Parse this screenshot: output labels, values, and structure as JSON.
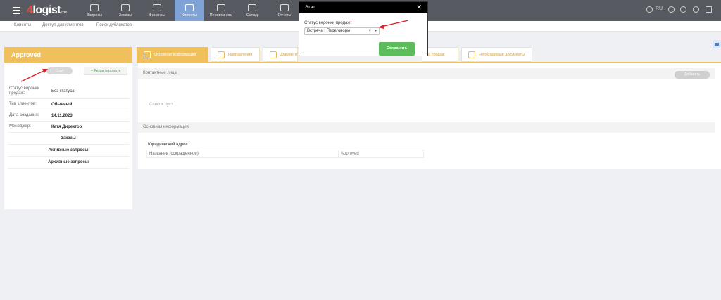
{
  "header": {
    "logo_prefix": "4",
    "logo_text": "logist",
    "logo_suffix": ".com",
    "nav": [
      {
        "label": "Запросы"
      },
      {
        "label": "Заказы"
      },
      {
        "label": "Финансы"
      },
      {
        "label": "Клиенты"
      },
      {
        "label": "Перевозчики"
      },
      {
        "label": "Склад"
      },
      {
        "label": "Отчеты"
      }
    ],
    "lang": "RU"
  },
  "subnav": {
    "items": [
      "Клиенты",
      "Доступ для клиентов",
      "Поиск дубликатов"
    ]
  },
  "client": {
    "name": "Approved",
    "etap_button": "Этап",
    "edit_button": "+ Редактировать",
    "fields": [
      {
        "label": "Статус воронки продаж:",
        "value": "Без статуса"
      },
      {
        "label": "Тип клиентов:",
        "value": "Обычный"
      },
      {
        "label": "Дата создания:",
        "value": "14.11.2023"
      },
      {
        "label": "Менеджер:",
        "value": "Катя Директор"
      }
    ],
    "links": [
      "Заказы",
      "Активные запросы",
      "Архивные запросы"
    ]
  },
  "tabs": [
    {
      "label": "Основная информация",
      "active": true
    },
    {
      "label": "Направления",
      "active": false
    },
    {
      "label": "Документ",
      "active": false
    },
    {
      "label": "а продаж",
      "active": false
    },
    {
      "label": "Необходимые документы",
      "active": false
    }
  ],
  "contacts": {
    "title": "Контактные лица",
    "add_button": "Добавить",
    "empty_text": "Список пуст..."
  },
  "basic_info": {
    "title": "Основная информация",
    "address_title": "Юридический адрес:",
    "row_label": "Название (сокращенное):",
    "row_value": "Approved"
  },
  "modal": {
    "title": "Этап",
    "close": "✕",
    "field_label": "Статус воронки продаж",
    "required_mark": "*",
    "selected_value": "Встреча | Переговоры",
    "clear": "×",
    "caret": "▾",
    "save_button": "Сохранить"
  },
  "colors": {
    "topbar": "#575a60",
    "active_nav": "#7fa3d6",
    "accent": "#f0c05c",
    "save": "#5cbc5c",
    "annotation_arrow": "#d9222a"
  }
}
